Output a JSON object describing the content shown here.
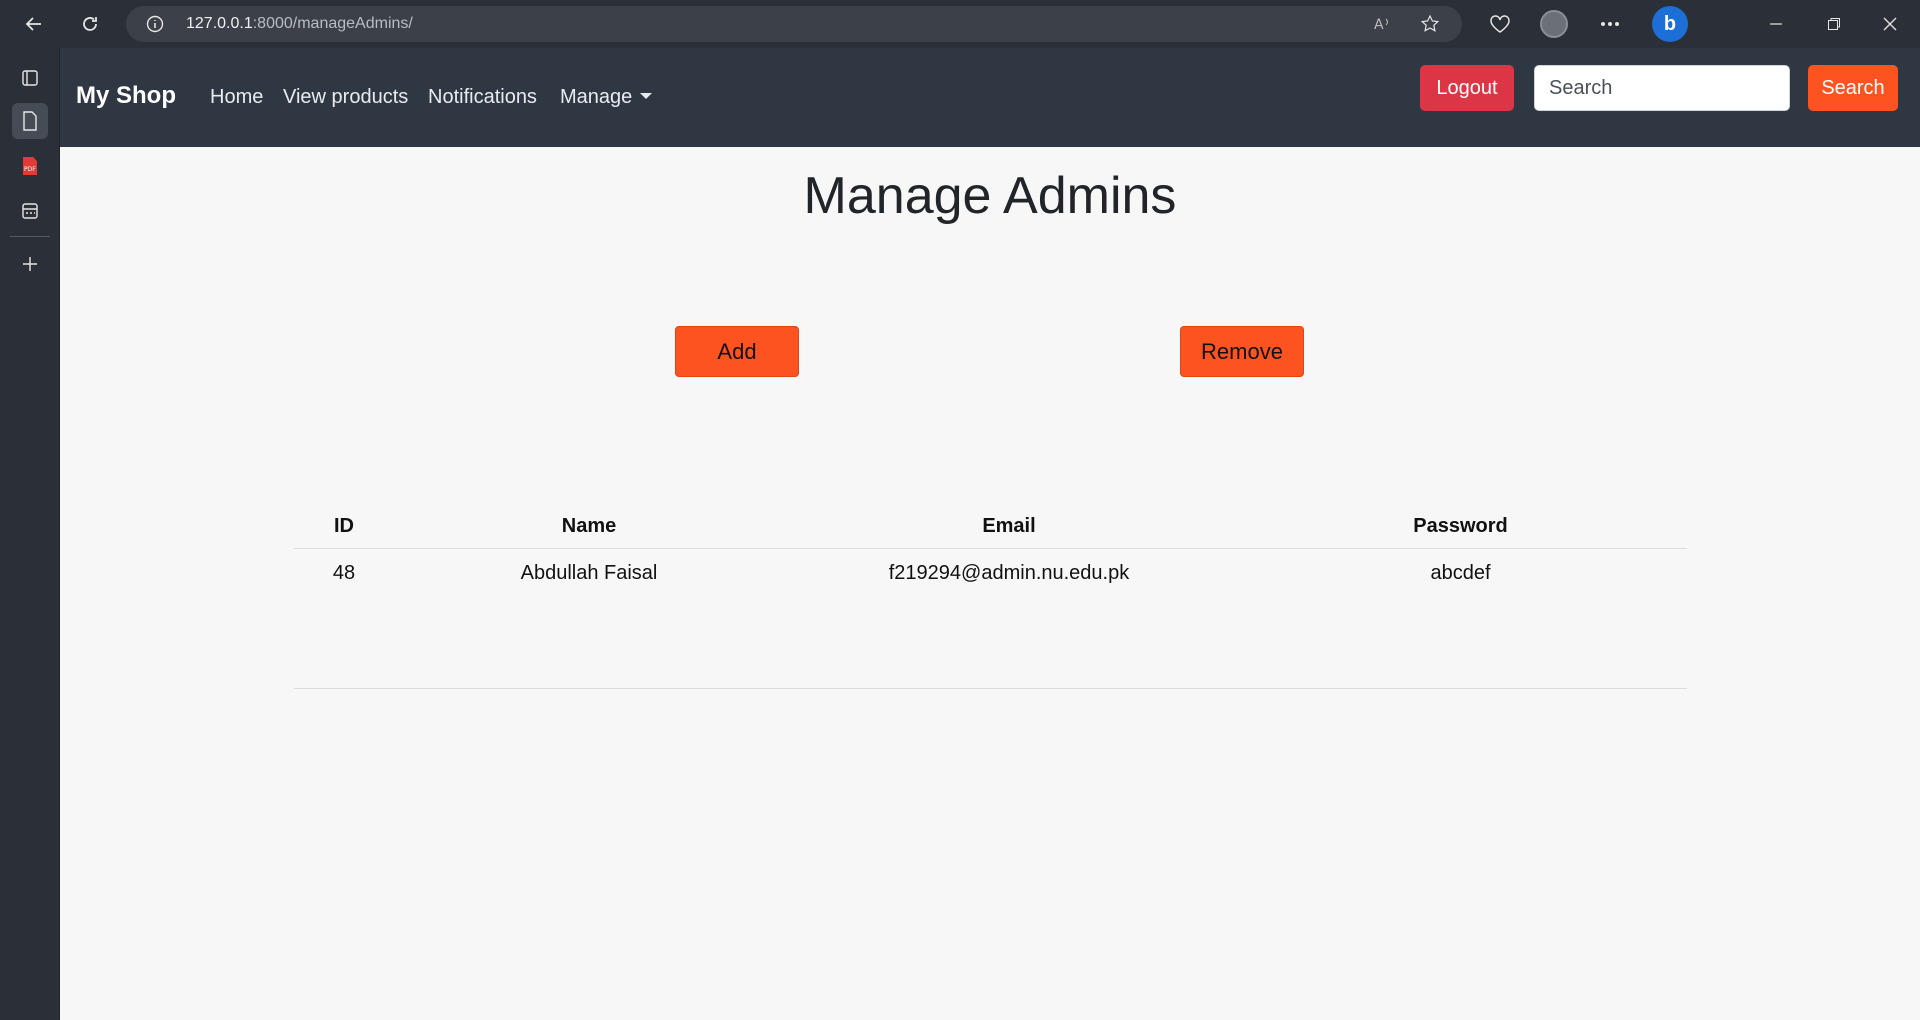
{
  "browser": {
    "url_host": "127.0.0.1",
    "url_rest": ":8000/manageAdmins/"
  },
  "navbar": {
    "brand": "My Shop",
    "links": [
      "Home",
      "View products",
      "Notifications",
      "Manage"
    ],
    "logout_label": "Logout",
    "search_placeholder": "Search",
    "search_button_label": "Search"
  },
  "main": {
    "title": "Manage Admins",
    "add_label": "Add",
    "remove_label": "Remove",
    "table": {
      "headers": [
        "ID",
        "Name",
        "Email",
        "Password"
      ],
      "rows": [
        [
          "48",
          "Abdullah Faisal",
          "f219294@admin.nu.edu.pk",
          "abcdef"
        ]
      ]
    }
  },
  "colors": {
    "navbar_bg": "#2f3742",
    "accent_orange": "#fd5320",
    "logout_red": "#dc3545",
    "page_bg": "#f7f7f7"
  }
}
